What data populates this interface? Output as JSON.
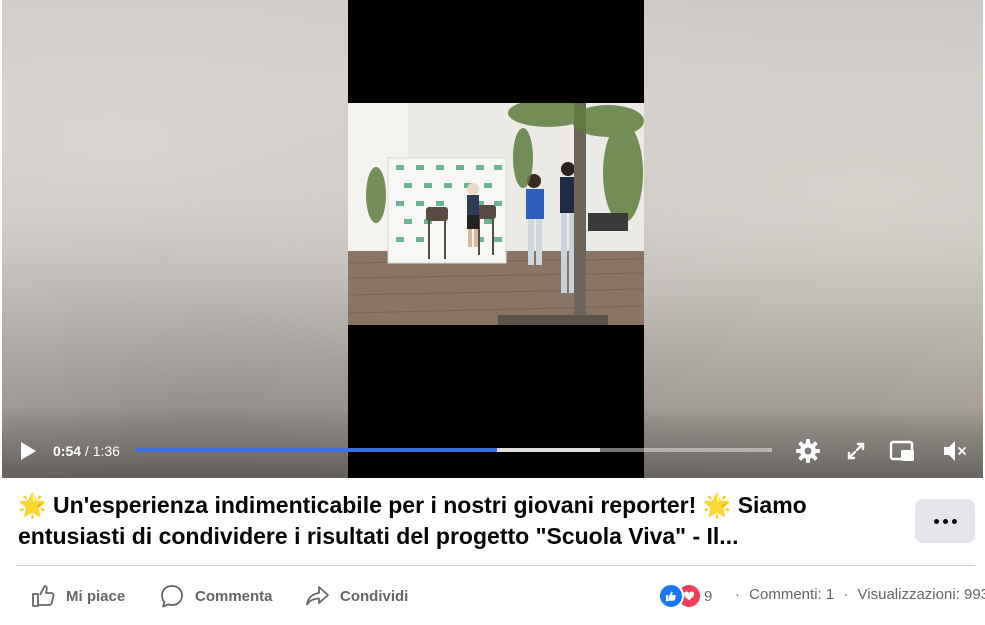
{
  "video": {
    "current_time": "0:54",
    "separator": "/",
    "duration": "1:36",
    "played_fraction": 0.568,
    "buffered_fraction": 0.73,
    "accent_color": "#3b6fe0"
  },
  "post": {
    "emoji": "🌟",
    "line1_text": "Un'esperienza indimenticabile per i nostri giovani reporter!",
    "line1_tail": "Siamo",
    "line2_text": "entusiasti di condividere i risultati del progetto \"Scuola Viva\" - Il..."
  },
  "actions": {
    "like_label": "Mi piace",
    "comment_label": "Commenta",
    "share_label": "Condividi"
  },
  "stats": {
    "reactions_count": "9",
    "comments": "Commenti: 1",
    "views": "Visualizzazioni: 993"
  },
  "icons": {
    "play": "play-icon",
    "settings": "gear-icon",
    "fullscreen": "expand-icon",
    "pip": "picture-in-picture-icon",
    "mute": "speaker-muted-icon",
    "more": "more-options-icon"
  }
}
